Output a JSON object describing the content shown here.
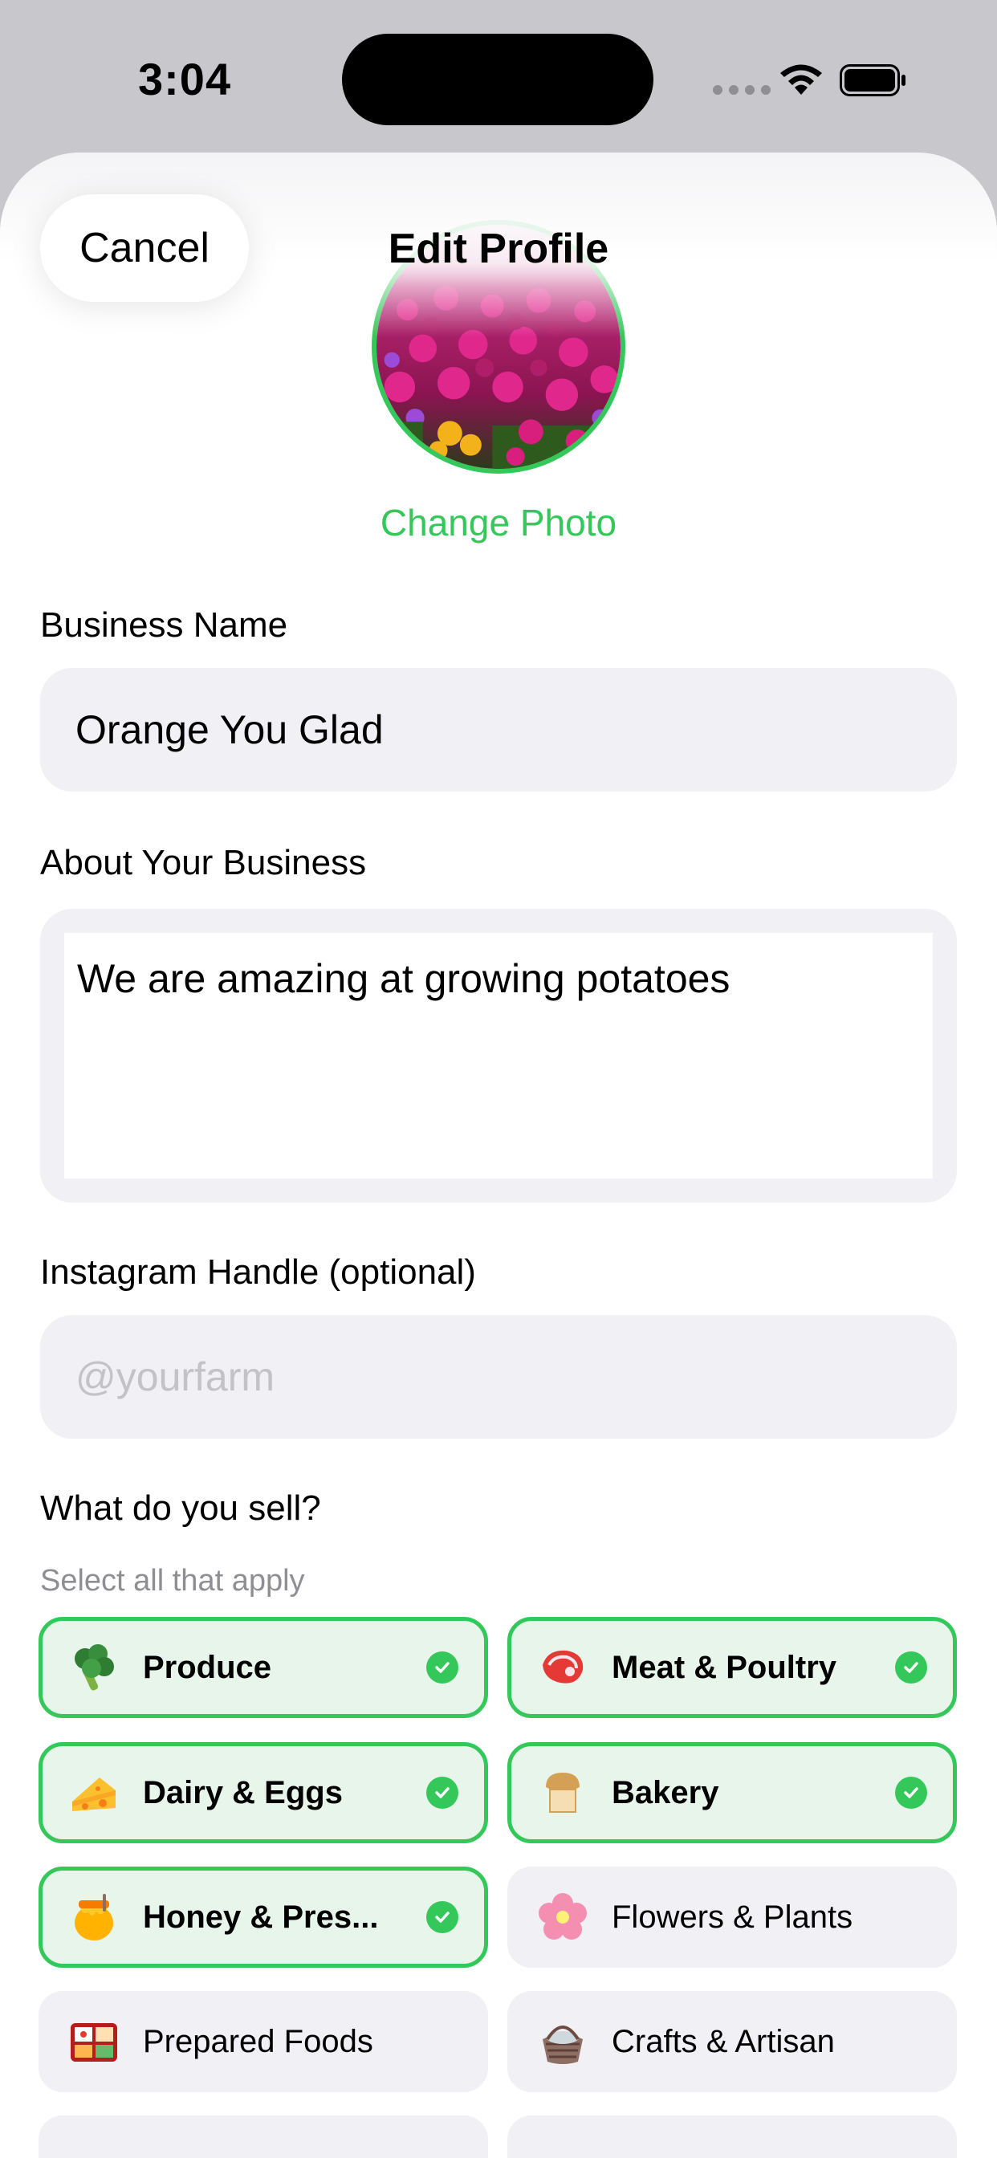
{
  "status_bar": {
    "time": "3:04"
  },
  "header": {
    "cancel_label": "Cancel",
    "title": "Edit Profile"
  },
  "photo": {
    "change_label": "Change Photo"
  },
  "business_name": {
    "label": "Business Name",
    "value": "Orange You Glad"
  },
  "about": {
    "label": "About Your Business",
    "value": "We are amazing at growing potatoes"
  },
  "instagram": {
    "label": "Instagram Handle (optional)",
    "placeholder": "@yourfarm",
    "value": ""
  },
  "sell": {
    "label": "What do you sell?",
    "hint": "Select all that apply",
    "categories": [
      {
        "label": "Produce",
        "icon": "broccoli-icon",
        "selected": true
      },
      {
        "label": "Meat & Poultry",
        "icon": "meat-icon",
        "selected": true
      },
      {
        "label": "Dairy & Eggs",
        "icon": "cheese-icon",
        "selected": true
      },
      {
        "label": "Bakery",
        "icon": "bread-icon",
        "selected": true
      },
      {
        "label": "Honey & Pres...",
        "icon": "honey-pot-icon",
        "selected": true
      },
      {
        "label": "Flowers & Plants",
        "icon": "flower-icon",
        "selected": false
      },
      {
        "label": "Prepared Foods",
        "icon": "bento-box-icon",
        "selected": false
      },
      {
        "label": "Crafts & Artisan",
        "icon": "basket-icon",
        "selected": false
      }
    ]
  },
  "colors": {
    "accent": "#34c759",
    "field_bg": "#f0f0f5",
    "selected_bg": "#e8f5ea"
  }
}
